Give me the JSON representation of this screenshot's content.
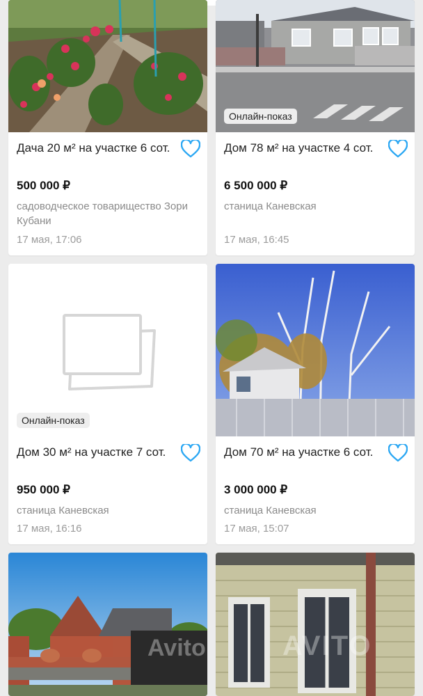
{
  "colors": {
    "accent": "#2ba7f3",
    "price": "#111111",
    "muted": "#8a8a8a",
    "background": "#ececec"
  },
  "listings": [
    {
      "title": "Дача 20 м² на участке 6 сот.",
      "price": "500 000 ₽",
      "address": "садоводческое товарищество Зори Кубани",
      "date": "17 мая, 17:06",
      "photo": "garden-roses",
      "favorite_icon": "heart-outline-icon"
    },
    {
      "title": "Дом 78 м² на участке 4 сот.",
      "price": "6 500 000 ₽",
      "address": "станица Каневская",
      "date": "17 мая, 16:45",
      "badge": "Онлайн-показ",
      "photo": "street-house",
      "favorite_icon": "heart-outline-icon"
    },
    {
      "title": "Дом 30 м² на участке 7 сот.",
      "price": "950 000 ₽",
      "address": "станица Каневская",
      "date": "17 мая, 16:16",
      "badge": "Онлайн-показ",
      "photo": "no-photo-placeholder",
      "favorite_icon": "heart-outline-icon"
    },
    {
      "title": "Дом 70 м² на участке 6 сот.",
      "price": "3 000 000 ₽",
      "address": "станица Каневская",
      "date": "17 мая, 15:07",
      "photo": "birch-trees-house",
      "favorite_icon": "heart-outline-icon"
    },
    {
      "photo": "brick-house-gate",
      "watermark": "Avito"
    },
    {
      "photo": "siding-house-windows",
      "watermark": "AVITO"
    }
  ]
}
